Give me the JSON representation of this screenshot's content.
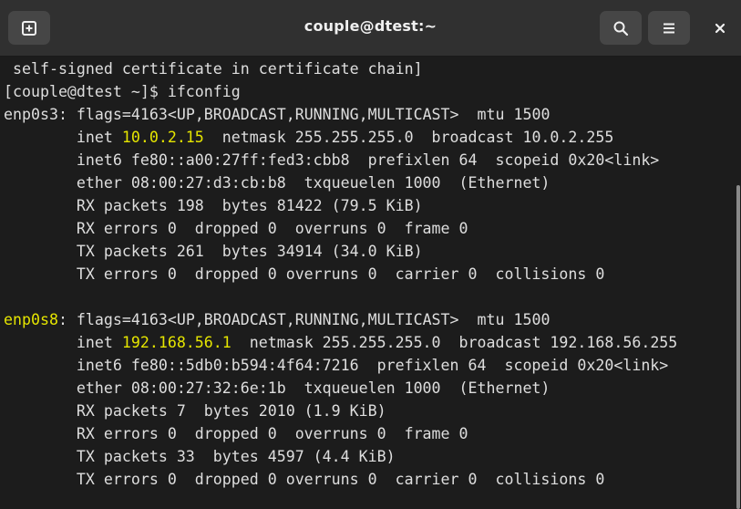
{
  "window": {
    "title": "couple@dtest:~"
  },
  "titlebar": {
    "new_tab_icon": "new-tab-icon",
    "search_icon": "search-icon",
    "menu_icon": "hamburger-menu-icon",
    "close_icon": "close-icon"
  },
  "colors": {
    "titlebar_bg": "#303030",
    "terminal_bg": "#1c1c1c",
    "text": "#dedede",
    "highlight": "#e5e500"
  },
  "terminal": {
    "lines": [
      {
        "text": " self-signed certificate in certificate chain]"
      },
      {
        "text": "[couple@dtest ~]$ ifconfig"
      },
      {
        "pre": "enp0s3",
        "text": ": flags=4163<UP,BROADCAST,RUNNING,MULTICAST>  mtu 1500"
      },
      {
        "pre": "        inet ",
        "hl": "10.0.2.15",
        "text": "  netmask 255.255.255.0  broadcast 10.0.2.255"
      },
      {
        "text": "        inet6 fe80::a00:27ff:fed3:cbb8  prefixlen 64  scopeid 0x20<link>"
      },
      {
        "text": "        ether 08:00:27:d3:cb:b8  txqueuelen 1000  (Ethernet)"
      },
      {
        "text": "        RX packets 198  bytes 81422 (79.5 KiB)"
      },
      {
        "text": "        RX errors 0  dropped 0  overruns 0  frame 0"
      },
      {
        "text": "        TX packets 261  bytes 34914 (34.0 KiB)"
      },
      {
        "text": "        TX errors 0  dropped 0 overruns 0  carrier 0  collisions 0"
      },
      {
        "text": ""
      },
      {
        "hl": "enp0s8",
        "text": ": flags=4163<UP,BROADCAST,RUNNING,MULTICAST>  mtu 1500"
      },
      {
        "pre": "        inet ",
        "hl": "192.168.56.1",
        "text": "  netmask 255.255.255.0  broadcast 192.168.56.255"
      },
      {
        "text": "        inet6 fe80::5db0:b594:4f64:7216  prefixlen 64  scopeid 0x20<link>"
      },
      {
        "text": "        ether 08:00:27:32:6e:1b  txqueuelen 1000  (Ethernet)"
      },
      {
        "text": "        RX packets 7  bytes 2010 (1.9 KiB)"
      },
      {
        "text": "        RX errors 0  dropped 0  overruns 0  frame 0"
      },
      {
        "text": "        TX packets 33  bytes 4597 (4.4 KiB)"
      },
      {
        "text": "        TX errors 0  dropped 0 overruns 0  carrier 0  collisions 0"
      }
    ]
  }
}
